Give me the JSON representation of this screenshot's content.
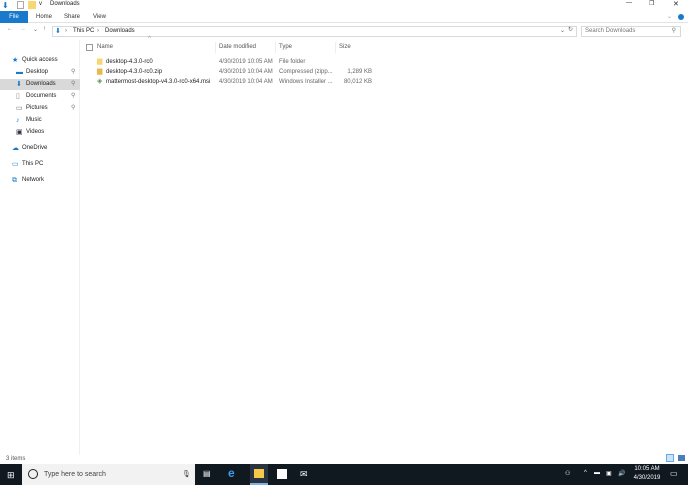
{
  "window": {
    "title": "Downloads",
    "qat_chevron": "v"
  },
  "ribbon": {
    "tabs": [
      "File",
      "Home",
      "Share",
      "View"
    ]
  },
  "address": {
    "path": [
      "This PC",
      "Downloads"
    ],
    "search_placeholder": "Search Downloads"
  },
  "nav": {
    "items": [
      {
        "label": "Quick access",
        "icon": "star-icon",
        "pinned": false
      },
      {
        "label": "Desktop",
        "icon": "desktop-icon",
        "pinned": true
      },
      {
        "label": "Downloads",
        "icon": "download-icon",
        "pinned": true,
        "selected": true
      },
      {
        "label": "Documents",
        "icon": "document-icon",
        "pinned": true
      },
      {
        "label": "Pictures",
        "icon": "pictures-icon",
        "pinned": true
      },
      {
        "label": "Music",
        "icon": "music-icon",
        "pinned": false
      },
      {
        "label": "Videos",
        "icon": "video-icon",
        "pinned": false
      },
      {
        "label": "OneDrive",
        "icon": "cloud-icon",
        "pinned": false
      },
      {
        "label": "This PC",
        "icon": "computer-icon",
        "pinned": false
      },
      {
        "label": "Network",
        "icon": "network-icon",
        "pinned": false
      }
    ]
  },
  "columns": [
    "Name",
    "Date modified",
    "Type",
    "Size"
  ],
  "files": [
    {
      "name": "desktop-4.3.0-rc0",
      "date": "4/30/2019 10:05 AM",
      "type": "File folder",
      "size": "",
      "icon": "folder-icon"
    },
    {
      "name": "desktop-4.3.0-rc0.zip",
      "date": "4/30/2019 10:04 AM",
      "type": "Compressed (zipp...",
      "size": "1,289 KB",
      "icon": "zip-folder-icon"
    },
    {
      "name": "mattermost-desktop-v4.3.0-rc0-x64.msi",
      "date": "4/30/2019 10:04 AM",
      "type": "Windows Installer ...",
      "size": "80,012 KB",
      "icon": "installer-icon"
    }
  ],
  "status": {
    "count": "3 items"
  },
  "taskbar": {
    "search_placeholder": "Type here to search",
    "time": "10:05 AM",
    "date": "4/30/2019"
  },
  "colors": {
    "accent": "#1979ca",
    "taskbar": "#101820",
    "selected": "#d9d9d9"
  }
}
